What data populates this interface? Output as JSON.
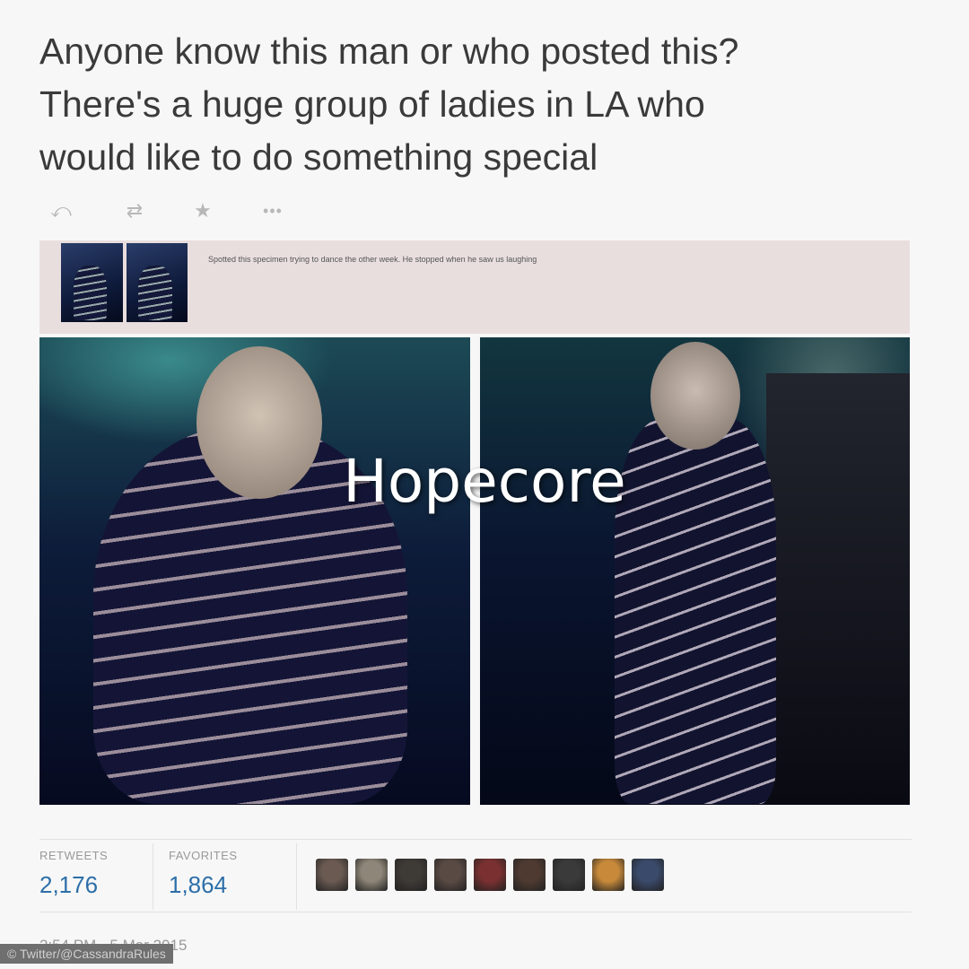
{
  "tweet": {
    "text_lines": [
      "Anyone know this man or who posted this?",
      "There's a huge group of ladies in LA who",
      "would like to do something special"
    ],
    "actions": {
      "reply_icon": "reply-icon",
      "retweet_icon": "retweet-icon",
      "favorite_icon": "star-icon",
      "more_icon": "more-icon",
      "reply_glyph": "⤺",
      "retweet_glyph": "⇄",
      "favorite_glyph": "★",
      "more_glyph": "•••"
    }
  },
  "embedded_post": {
    "caption": "Spotted this specimen trying to dance the other week. He stopped when he saw us laughing"
  },
  "overlay": {
    "watermark": "Hopecore"
  },
  "stats": {
    "retweets_label": "RETWEETS",
    "retweets_value": "2,176",
    "favorites_label": "FAVORITES",
    "favorites_value": "1,864"
  },
  "avatars": {
    "colors": [
      "#6a5a52",
      "#8e8678",
      "#3e3a36",
      "#5a4a44",
      "#7a3030",
      "#4e3a30",
      "#3a3a3a",
      "#c88a3a",
      "#3a4a6a"
    ]
  },
  "footer": {
    "timestamp": "2:54 PM - 5 Mar 2015",
    "credit": "© Twitter/@CassandraRules"
  }
}
